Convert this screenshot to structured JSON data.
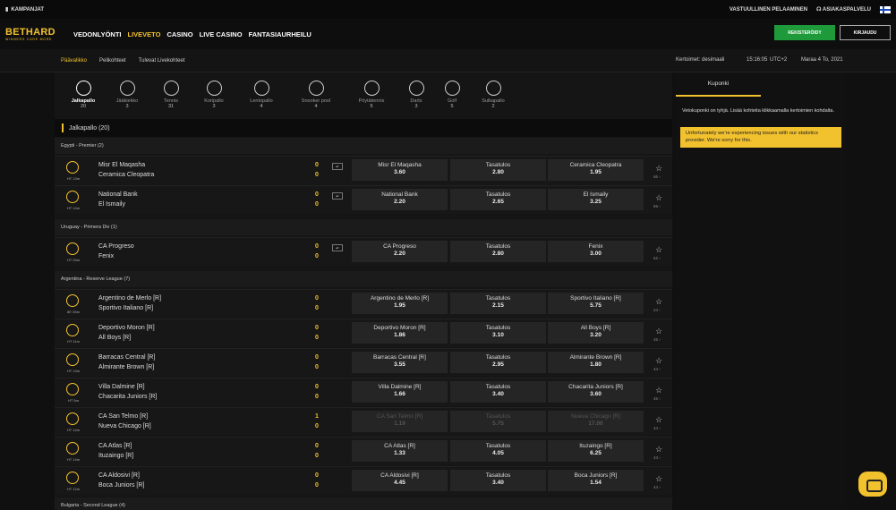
{
  "topbar": {
    "campaigns": "KAMPANJAT",
    "responsible": "VASTUULLINEN PELAAMINEN",
    "support": "ASIAKASPALVELU"
  },
  "brand": {
    "name": "BETHARD",
    "tagline": "WINNERS CARE MORE",
    "accent": "#f2c12e"
  },
  "nav": [
    "VEDONLYÖNTI",
    "LIVEVETO",
    "CASINO",
    "LIVE CASINO",
    "FANTASIAURHEILU"
  ],
  "buttons": {
    "register": "REKISTERÖIDY",
    "login": "KIRJAUDU"
  },
  "subnav": {
    "tabs": [
      "Päävalikko",
      "Pelikohteet",
      "Tulevat Livekohteet"
    ],
    "odds_format": "Kertoimet: desimaali",
    "time": "15:16:05",
    "tz": "UTC+2",
    "date": "Maraa 4 To, 2021"
  },
  "sports": [
    {
      "name": "Jalkapallo",
      "count": "20"
    },
    {
      "name": "Jääkiekko",
      "count": "3"
    },
    {
      "name": "Tennis",
      "count": "31"
    },
    {
      "name": "Koripallo",
      "count": "3"
    },
    {
      "name": "Lentopallo",
      "count": "4"
    },
    {
      "name": "Snooker pool",
      "count": "4"
    },
    {
      "name": "Pöytätennis",
      "count": "5"
    },
    {
      "name": "Darts",
      "count": "3"
    },
    {
      "name": "Golf",
      "count": "5"
    },
    {
      "name": "Sulkapallo",
      "count": "2"
    }
  ],
  "section": {
    "title": "Jalkapallo (20)"
  },
  "leagues": [
    "Egypti - Premier (2)",
    "Uruguay - Primera Div (1)",
    "Argentina - Reserve League (7)",
    "Bulgaria - Second League (4)"
  ],
  "matches": [
    {
      "time": "HT 13m",
      "home": "Misr El Maqasha",
      "away": "Ceramica Cleopatra",
      "hs": "0",
      "as": "0",
      "o1": "Misr El Maqasha",
      "v1": "3.60",
      "ox": "Tasatulos",
      "vx": "2.80",
      "o2": "Ceramica Cleopatra",
      "v2": "1.95",
      "more": "66"
    },
    {
      "time": "HT 14m",
      "home": "National Bank",
      "away": "El Ismaily",
      "hs": "0",
      "as": "0",
      "o1": "National Bank",
      "v1": "2.20",
      "ox": "Tasatulos",
      "vx": "2.65",
      "o2": "El Ismaily",
      "v2": "3.25",
      "more": "65"
    },
    {
      "time": "HT 25m",
      "home": "CA Progreso",
      "away": "Fenix",
      "hs": "0",
      "as": "0",
      "o1": "CA Progreso",
      "v1": "2.20",
      "ox": "Tasatulos",
      "vx": "2.80",
      "o2": "Fenix",
      "v2": "3.00",
      "more": "62"
    },
    {
      "time": "80' 55m",
      "home": "Argentino de Merlo [R]",
      "away": "Sportivo Italiano [R]",
      "hs": "0",
      "as": "0",
      "o1": "Argentino de Merlo [R]",
      "v1": "1.95",
      "ox": "Tasatulos",
      "vx": "2.15",
      "o2": "Sportivo Italiano [R]",
      "v2": "5.75",
      "more": "24"
    },
    {
      "time": "HT 11m",
      "home": "Deportivo Moron [R]",
      "away": "All Boys [R]",
      "hs": "0",
      "as": "0",
      "o1": "Deportivo Moron [R]",
      "v1": "1.86",
      "ox": "Tasatulos",
      "vx": "3.10",
      "o2": "All Boys [R]",
      "v2": "3.20",
      "more": "45"
    },
    {
      "time": "HT 13m",
      "home": "Barracas Central [R]",
      "away": "Almirante Brown [R]",
      "hs": "0",
      "as": "0",
      "o1": "Barracas Central [R]",
      "v1": "3.55",
      "ox": "Tasatulos",
      "vx": "2.95",
      "o2": "Almirante Brown [R]",
      "v2": "1.80",
      "more": "44"
    },
    {
      "time": "HT 5m",
      "home": "Villa Dalmine [R]",
      "away": "Chacarita Juniors [R]",
      "hs": "0",
      "as": "0",
      "o1": "Villa Dalmine [R]",
      "v1": "1.66",
      "ox": "Tasatulos",
      "vx": "3.40",
      "o2": "Chacarita Juniors [R]",
      "v2": "3.60",
      "more": "45"
    },
    {
      "time": "HT 14m",
      "home": "CA San Telmo [R]",
      "away": "Nueva Chicago [R]",
      "hs": "1",
      "as": "0",
      "o1": "CA San Telmo [R]",
      "v1": "1.19",
      "ox": "Tasatulos",
      "vx": "5.75",
      "o2": "Nueva Chicago [R]",
      "v2": "17.00",
      "more": "44"
    },
    {
      "time": "HT 14m",
      "home": "CA Atlas [R]",
      "away": "Ituzaingo [R]",
      "hs": "0",
      "as": "0",
      "o1": "CA Atlas [R]",
      "v1": "1.33",
      "ox": "Tasatulos",
      "vx": "4.05",
      "o2": "Ituzaingo [R]",
      "v2": "6.25",
      "more": "43"
    },
    {
      "time": "HT 12m",
      "home": "CA Aldosivi [R]",
      "away": "Boca Juniors [R]",
      "hs": "0",
      "as": "0",
      "o1": "CA Aldosivi [R]",
      "v1": "4.45",
      "ox": "Tasatulos",
      "vx": "3.40",
      "o2": "Boca Juniors [R]",
      "v2": "1.54",
      "more": "44"
    }
  ],
  "coupon": {
    "tab": "Kuponki",
    "empty": "Vetokuponki on tyhjä. Lisää kohteita klikkaamalla kertoimien kohdalta.",
    "warning": "Unfortunately we're experiencing issues with our statistics provider. We're sorry for this."
  }
}
